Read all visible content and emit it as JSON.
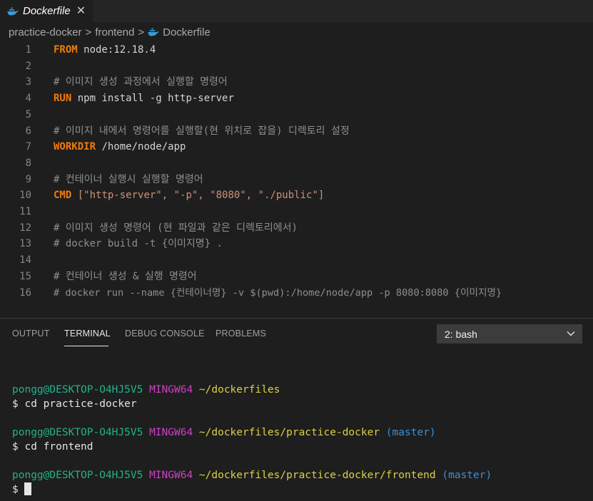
{
  "tab": {
    "title": "Dockerfile",
    "close": "✕",
    "icon": "docker-icon"
  },
  "breadcrumb": {
    "parts": [
      "practice-docker",
      "frontend",
      "Dockerfile"
    ],
    "sep": ">"
  },
  "editor": {
    "lines": [
      {
        "n": "1",
        "kw": "FROM",
        "rest": " node:12.18.4"
      },
      {
        "n": "2"
      },
      {
        "n": "3",
        "comment": "# 이미지 생성 과정에서 실행할 명령어"
      },
      {
        "n": "4",
        "kw": "RUN",
        "rest": " npm install -g http-server"
      },
      {
        "n": "5"
      },
      {
        "n": "6",
        "comment": "# 이미지 내에서 명령어를 실행할(현 위치로 잡을) 디렉토리 설정"
      },
      {
        "n": "7",
        "kw": "WORKDIR",
        "rest": " /home/node/app"
      },
      {
        "n": "8"
      },
      {
        "n": "9",
        "comment": "# 컨테이너 실행시 실행할 명령어"
      },
      {
        "n": "10",
        "kw": "CMD",
        "rest": " [\"http-server\", \"-p\", \"8080\", \"./public\"]"
      },
      {
        "n": "11"
      },
      {
        "n": "12",
        "comment": "# 이미지 생성 명령어 (현 파일과 같은 디렉토리에서)"
      },
      {
        "n": "13",
        "comment": "# docker build -t {이미지명} ."
      },
      {
        "n": "14"
      },
      {
        "n": "15",
        "comment": "# 컨테이너 생성 & 실행 명령어"
      },
      {
        "n": "16",
        "comment": "# docker run --name {컨테이너명} -v $(pwd):/home/node/app -p 8080:8080 {이미지명}"
      }
    ]
  },
  "panel": {
    "tabs": [
      "OUTPUT",
      "TERMINAL",
      "DEBUG CONSOLE",
      "PROBLEMS"
    ],
    "active_tab": "TERMINAL",
    "terminal_select": "2: bash"
  },
  "terminal": {
    "blocks": [
      {
        "user": "pongg@DESKTOP-O4HJ5V5",
        "shell": "MINGW64",
        "path": "~/dockerfiles",
        "branch": "",
        "cmd": "$ cd practice-docker"
      },
      {
        "user": "pongg@DESKTOP-O4HJ5V5",
        "shell": "MINGW64",
        "path": "~/dockerfiles/practice-docker",
        "branch": "(master)",
        "cmd": "$ cd frontend"
      },
      {
        "user": "pongg@DESKTOP-O4HJ5V5",
        "shell": "MINGW64",
        "path": "~/dockerfiles/practice-docker/frontend",
        "branch": "(master)",
        "cmd": "$ "
      }
    ]
  },
  "colors": {
    "keyword": "#f07b0e",
    "comment": "#8f8f8f",
    "user": "#23b28a",
    "shell": "#d13fc5",
    "path": "#dcd047",
    "branch": "#3a8fd9"
  }
}
